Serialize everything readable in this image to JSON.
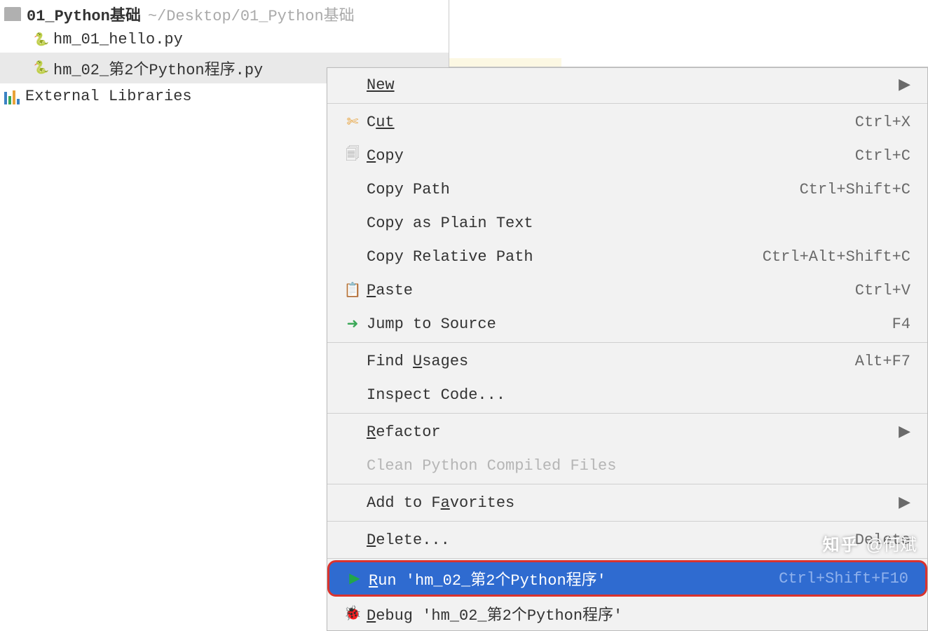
{
  "project": {
    "name": "01_Python基础",
    "path": "~/Desktop/01_Python基础"
  },
  "tree": {
    "file1": "hm_01_hello.py",
    "file2": "hm_02_第2个Python程序.py",
    "external": "External Libraries"
  },
  "menu": {
    "new": "New",
    "cut": "Cut",
    "cut_pre": "C",
    "cut_post": "ut",
    "cut_sc": "Ctrl+X",
    "copy_pre": "C",
    "copy_post": "opy",
    "copy_sc": "Ctrl+C",
    "copy_path": "Copy Path",
    "copy_path_sc": "Ctrl+Shift+C",
    "copy_plain": "Copy as Plain Text",
    "copy_rel": "Copy Relative Path",
    "copy_rel_sc": "Ctrl+Alt+Shift+C",
    "paste_pre": "P",
    "paste_post": "aste",
    "paste_sc": "Ctrl+V",
    "jump": "Jump to Source",
    "jump_sc": "F4",
    "find_pre": "Find ",
    "find_u": "U",
    "find_post": "sages",
    "find_sc": "Alt+F7",
    "inspect": "Inspect Code...",
    "refactor_pre": "R",
    "refactor_post": "efactor",
    "clean": "Clean Python Compiled Files",
    "fav_pre": "Add to F",
    "fav_u": "a",
    "fav_post": "vorites",
    "delete_pre": "D",
    "delete_post": "elete...",
    "delete_sc": "Delete",
    "run_pre": "R",
    "run_post": "un 'hm_02_第2个Python程序'",
    "run_sc": "Ctrl+Shift+F10",
    "debug_pre": "D",
    "debug_post": "ebug 'hm_02_第2个Python程序'"
  },
  "watermark": {
    "logo": "知乎",
    "author": "@何斌"
  }
}
